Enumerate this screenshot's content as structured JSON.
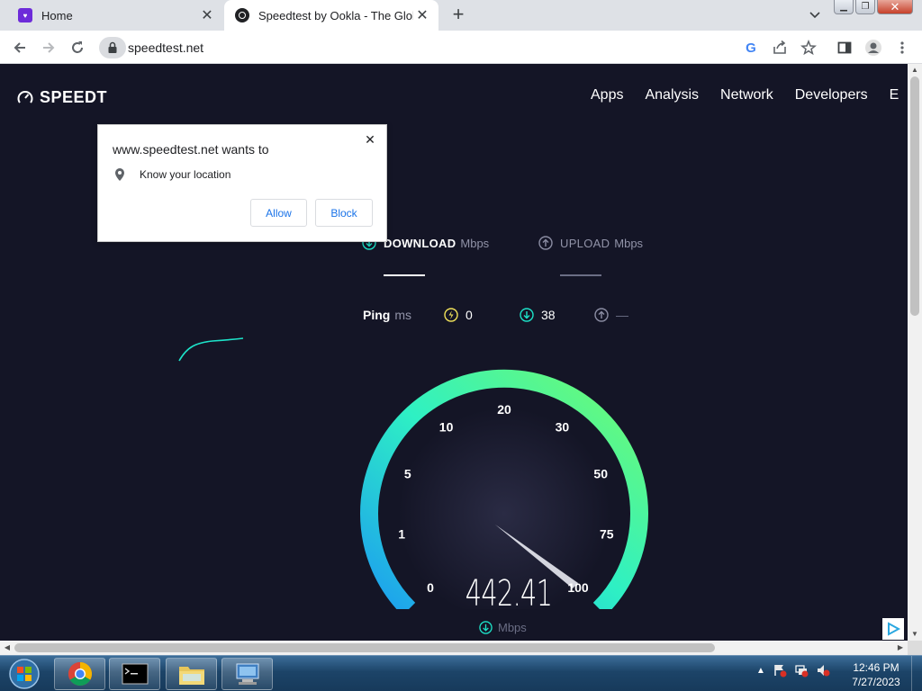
{
  "browser": {
    "tabs": [
      {
        "title": "Home",
        "favicon": "home-app-icon",
        "active": false
      },
      {
        "title": "Speedtest by Ookla - The Global",
        "favicon": "ookla-icon",
        "active": true
      }
    ],
    "url": "speedtest.net"
  },
  "site": {
    "brand": "SPEEDT",
    "nav": [
      "Apps",
      "Analysis",
      "Network",
      "Developers",
      "E"
    ]
  },
  "test": {
    "download_label": "DOWNLOAD",
    "upload_label": "UPLOAD",
    "unit": "Mbps",
    "ping_label": "Ping",
    "ping_unit": "ms",
    "ping_idle": "0",
    "ping_download": "38",
    "ping_upload": "—",
    "speed_value": "442.41",
    "speed_unit": "Mbps",
    "gauge_ticks": [
      "0",
      "1",
      "5",
      "10",
      "20",
      "30",
      "50",
      "75",
      "100"
    ],
    "colors": {
      "accent_teal": "#1de3c9",
      "accent_blue": "#20b8f0",
      "accent_green": "#6dfa7c",
      "background": "#141526"
    }
  },
  "popup": {
    "title": "www.speedtest.net wants to",
    "permission": "Know your location",
    "allow": "Allow",
    "block": "Block"
  },
  "taskbar": {
    "apps": [
      "chrome-icon",
      "cmd-icon",
      "explorer-icon",
      "network-program-icon"
    ],
    "time": "12:46 PM",
    "date": "7/27/2023"
  }
}
